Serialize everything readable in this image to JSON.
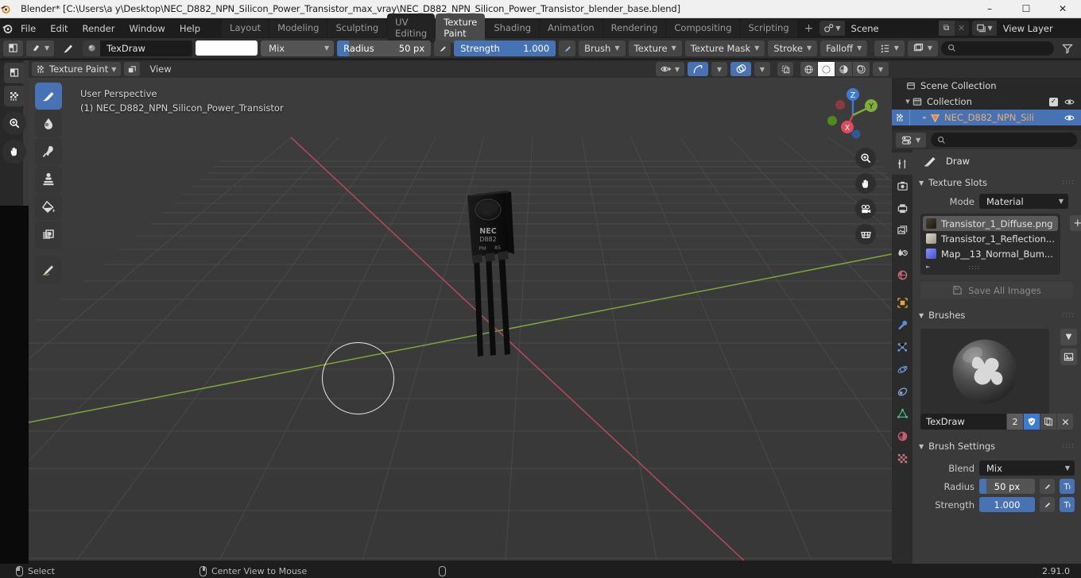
{
  "window": {
    "title": "Blender* [C:\\Users\\a y\\Desktop\\NEC_D882_NPN_Silicon_Power_Transistor_max_vray\\NEC_D882_NPN_Silicon_Power_Transistor_blender_base.blend]",
    "minimize": "–",
    "maximize": "☐",
    "close": "✕"
  },
  "topbar": {
    "menus": [
      "File",
      "Edit",
      "Render",
      "Window",
      "Help"
    ],
    "workspaces": [
      {
        "label": "Layout",
        "active": false
      },
      {
        "label": "Modeling",
        "active": false
      },
      {
        "label": "Sculpting",
        "active": false
      },
      {
        "label": "UV Editing",
        "active": false
      },
      {
        "label": "Texture Paint",
        "active": true
      },
      {
        "label": "Shading",
        "active": false
      },
      {
        "label": "Animation",
        "active": false
      },
      {
        "label": "Rendering",
        "active": false
      },
      {
        "label": "Compositing",
        "active": false
      },
      {
        "label": "Scripting",
        "active": false
      }
    ],
    "add_workspace": "+",
    "scene": {
      "name": "Scene",
      "new_label": "⧉",
      "remove_label": "✕"
    },
    "view_layer": {
      "name": "View Layer",
      "new_label": "⧉",
      "remove_label": "✕"
    }
  },
  "tool_settings": {
    "mode_icon": "texture-paint-mode-icon",
    "brush_preset": "brush-preset-icon",
    "brush_name": "TexDraw",
    "color_swatch": "#ffffff",
    "blend_mode": "Mix",
    "radius": {
      "label": "Radius",
      "value": "50 px",
      "fill_percent": 13
    },
    "strength": {
      "label": "Strength",
      "value": "1.000",
      "fill_percent": 100
    },
    "popovers": [
      "Brush",
      "Texture",
      "Texture Mask",
      "Stroke",
      "Falloff"
    ],
    "options_icon": "options-icon"
  },
  "viewport": {
    "mode": "Texture Paint",
    "view_menu": "View",
    "overlay_line1": "User Perspective",
    "overlay_line2": "(1) NEC_D882_NPN_Silicon_Power_Transistor",
    "gizmo_axes": [
      "Z",
      "Y",
      "X"
    ],
    "left_tools": [
      {
        "name": "draw-tool",
        "active": true
      },
      {
        "name": "soften-tool",
        "active": false
      },
      {
        "name": "smear-tool",
        "active": false
      },
      {
        "name": "clone-tool",
        "active": false
      },
      {
        "name": "fill-tool",
        "active": false
      },
      {
        "name": "mask-tool",
        "active": false
      },
      {
        "name": "annotate-tool",
        "active": false
      }
    ],
    "nav_buttons": [
      "zoom-icon",
      "pan-icon",
      "camera-icon",
      "ortho-grid-icon"
    ],
    "header_right": {
      "visibility": "eye-icon",
      "gizmos": "gizmo-icon",
      "overlays": "overlays-icon",
      "xray": "xray-icon",
      "shading": [
        "wireframe",
        "solid",
        "material-preview",
        "rendered"
      ],
      "active_shading": "solid"
    }
  },
  "outliner": {
    "display_mode_icon": "outliner-display-icon",
    "filter_icon": "filter-icon",
    "search_placeholder": "",
    "rows": [
      {
        "label": "Scene Collection",
        "icon": "scene-collection-icon",
        "indent": 0,
        "selected": false,
        "expandable": false,
        "checkbox": false,
        "eye": false
      },
      {
        "label": "Collection",
        "icon": "collection-icon",
        "indent": 1,
        "selected": false,
        "expandable": true,
        "checkbox": true,
        "eye": true
      },
      {
        "label": "NEC_D882_NPN_Sili",
        "icon": "mesh-object-icon",
        "indent": 2,
        "selected": true,
        "expandable": true,
        "checkbox": false,
        "eye": true
      }
    ]
  },
  "properties": {
    "editor_icon": "properties-editor-icon",
    "search_placeholder": "",
    "tabs": [
      {
        "name": "tool",
        "active": true,
        "color": "#d0d0d0"
      },
      {
        "name": "render",
        "active": false,
        "color": "#d0d0d0"
      },
      {
        "name": "output",
        "active": false,
        "color": "#d0d0d0"
      },
      {
        "name": "view-layer",
        "active": false,
        "color": "#d0d0d0"
      },
      {
        "name": "scene",
        "active": false,
        "color": "#d0d0d0"
      },
      {
        "name": "world",
        "active": false,
        "color": "#d16a7c"
      },
      {
        "name": "object",
        "active": false,
        "color": "#e8a33d"
      },
      {
        "name": "modifiers",
        "active": false,
        "color": "#5b8bd4"
      },
      {
        "name": "particles",
        "active": false,
        "color": "#6f9ad6"
      },
      {
        "name": "physics",
        "active": false,
        "color": "#6f9ad6"
      },
      {
        "name": "constraints",
        "active": false,
        "color": "#7fa8dd"
      },
      {
        "name": "object-data",
        "active": false,
        "color": "#4db88a"
      },
      {
        "name": "material",
        "active": false,
        "color": "#cc5b6e"
      },
      {
        "name": "texture",
        "active": false,
        "color": "#c4717c"
      }
    ],
    "brush_label": "Draw",
    "texture_slots": {
      "title": "Texture Slots",
      "mode_label": "Mode",
      "mode_value": "Material",
      "add_button": "+",
      "slots": [
        {
          "label": "Transistor_1_Diffuse.png",
          "thumb": "#3a3024",
          "selected": true
        },
        {
          "label": "Transistor_1_Reflection...",
          "thumb": "#b9b3a8",
          "selected": false
        },
        {
          "label": "Map__13_Normal_Bum...",
          "thumb": "#6a73e0",
          "selected": false
        }
      ],
      "save_all_label": "Save All Images"
    },
    "brushes": {
      "title": "Brushes",
      "name": "TexDraw",
      "users": "2",
      "fake_user_icon": "shield-icon",
      "duplicate_icon": "copy-icon",
      "delete_icon": "x-icon",
      "dropdown_icon": "chevron-down-icon",
      "preview_icon": "image-preview-icon"
    },
    "brush_settings": {
      "title": "Brush Settings",
      "blend_label": "Blend",
      "blend_value": "Mix",
      "radius_label": "Radius",
      "radius_value": "50 px",
      "radius_fill": 13,
      "strength_label": "Strength",
      "strength_value": "1.000",
      "strength_fill": 100
    }
  },
  "statusbar": {
    "items": [
      {
        "icon": "mouse-left-icon",
        "label": "Select"
      },
      {
        "icon": "mouse-middle-icon",
        "label": "Center View to Mouse"
      },
      {
        "icon": "mouse-right-icon",
        "label": ""
      }
    ],
    "version": "2.91.0"
  },
  "colors": {
    "accent_blue": "#4772b3",
    "header_gray": "#303030",
    "viewport_bg": "#3a3a3a",
    "x_axis": "#c44b5e",
    "y_axis": "#8ab83a",
    "z_axis": "#3b7cd3"
  }
}
